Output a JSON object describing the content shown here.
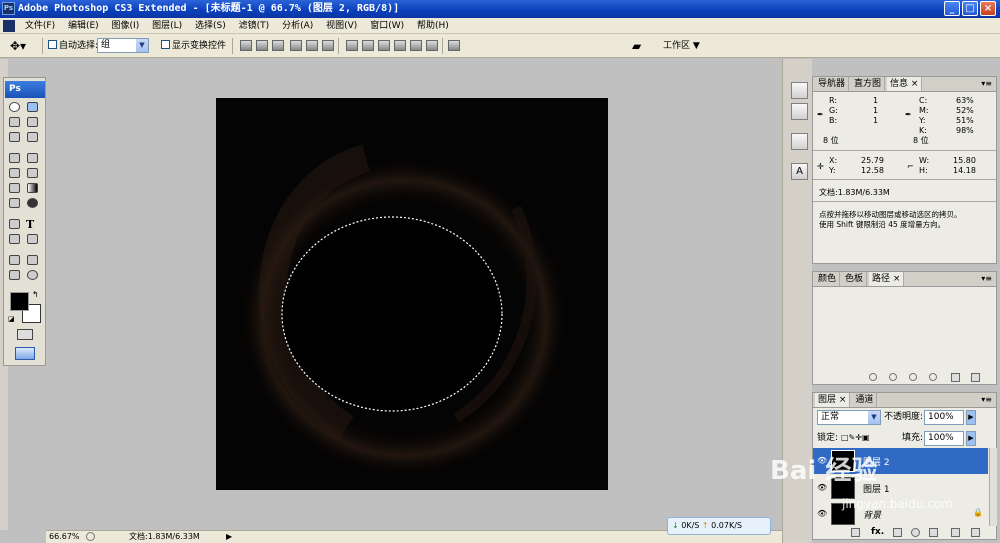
{
  "title": "Adobe Photoshop CS3 Extended - [未标题-1 @ 66.7% (图层 2, RGB/8)]",
  "app_icon": "Ps",
  "window_buttons": {
    "min": "_",
    "max": "□",
    "close": "×"
  },
  "menu": [
    "文件(F)",
    "编辑(E)",
    "图像(I)",
    "图层(L)",
    "选择(S)",
    "滤镜(T)",
    "分析(A)",
    "视图(V)",
    "窗口(W)",
    "帮助(H)"
  ],
  "options": {
    "auto_select": "自动选择:",
    "auto_select_value": "组",
    "show_transform": "显示变换控件",
    "workspace": "工作区 ▼"
  },
  "toolbox": {
    "logo": "Ps"
  },
  "status": {
    "zoom": "66.67%",
    "doc": "文档:1.83M/6.33M"
  },
  "info_panel": {
    "tabs": [
      "导航器",
      "直方图",
      "信息 ×"
    ],
    "rgb": {
      "r_label": "R:",
      "g_label": "G:",
      "b_label": "B:",
      "r": "1",
      "g": "1",
      "b": "1",
      "bits": "8 位"
    },
    "cmyk": {
      "c_label": "C:",
      "m_label": "M:",
      "y_label": "Y:",
      "k_label": "K:",
      "c": "63%",
      "m": "52%",
      "y": "51%",
      "k": "98%",
      "bits": "8 位"
    },
    "pos": {
      "x_label": "X:",
      "y_label": "Y:",
      "x": "25.79",
      "y": "12.58"
    },
    "size": {
      "w_label": "W:",
      "h_label": "H:",
      "w": "15.80",
      "h": "14.18"
    },
    "doc": "文档:1.83M/6.33M",
    "hint1": "点按并拖移以移动图层或移动选区的拷贝。",
    "hint2": "使用 Shift 键限制沿 45 度增量方向。"
  },
  "color_panel": {
    "tabs": [
      "颜色",
      "色板",
      "路径 ×"
    ]
  },
  "layers_panel": {
    "tabs": [
      "图层 ×",
      "通道"
    ],
    "blend": "正常",
    "opacity_label": "不透明度:",
    "opacity": "100%",
    "lock_label": "锁定:",
    "fill_label": "填充:",
    "fill": "100%",
    "layers": [
      {
        "name": "图层 2",
        "selected": true
      },
      {
        "name": "图层 1",
        "selected": false
      },
      {
        "name": "背景",
        "selected": false
      }
    ],
    "footer_icons": [
      "link-icon",
      "fx-icon",
      "mask-icon",
      "adjust-icon",
      "group-icon",
      "new-layer-icon",
      "trash-icon"
    ]
  },
  "speed": {
    "down": "0K/S",
    "up": "0.07K/S"
  },
  "watermark": {
    "brand": "Bai 经验",
    "url": "jingyan.baidu.com"
  },
  "colors": {
    "titlebar": "#0a3fbb",
    "canvas": "#050404",
    "selected_layer": "#316ac5"
  }
}
